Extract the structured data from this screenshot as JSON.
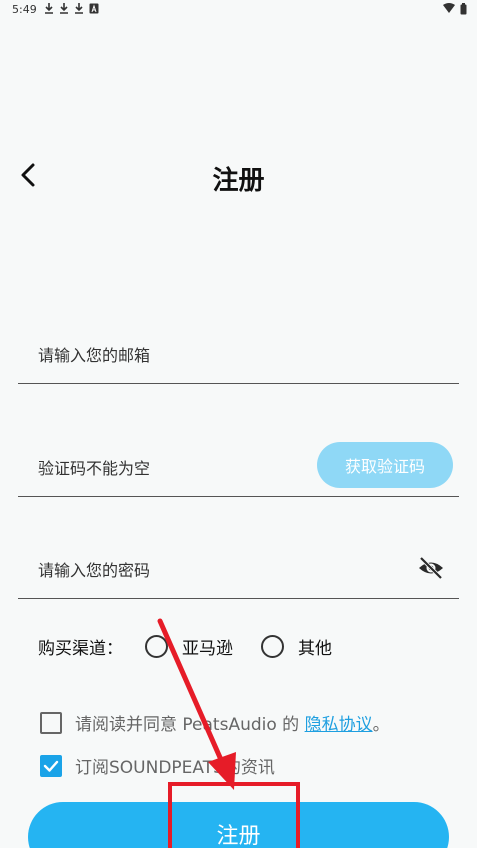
{
  "status_bar": {
    "time": "5:49",
    "left_icons": [
      "download-icon",
      "download-icon",
      "download-icon",
      "a-badge-icon"
    ],
    "right_icons": [
      "wifi-icon",
      "battery-icon"
    ]
  },
  "header": {
    "title": "注册",
    "back_icon": "chevron-left-icon"
  },
  "form": {
    "email": {
      "placeholder": "请输入您的邮箱",
      "value": ""
    },
    "code": {
      "placeholder": "验证码不能为空",
      "value": "",
      "button_label": "获取验证码"
    },
    "password": {
      "placeholder": "请输入您的密码",
      "value": "",
      "toggle_icon": "eye-off-icon"
    }
  },
  "channel": {
    "label": "购买渠道：",
    "options": [
      {
        "label": "亚马逊",
        "selected": false
      },
      {
        "label": "其他",
        "selected": false
      }
    ]
  },
  "agreement": {
    "checked": false,
    "text": "请阅读并同意 PeatsAudio 的 ",
    "link": "隐私协议",
    "suffix": "。"
  },
  "subscribe": {
    "checked": true,
    "text": "订阅SOUNDPEATS的资讯"
  },
  "register_button": {
    "label": "注册"
  },
  "colors": {
    "accent": "#25b4f2",
    "accent_light": "#8fd8f6",
    "link": "#1e9fe0",
    "checkbox_checked": "#1aa3e8",
    "annotation": "#e61c28"
  }
}
